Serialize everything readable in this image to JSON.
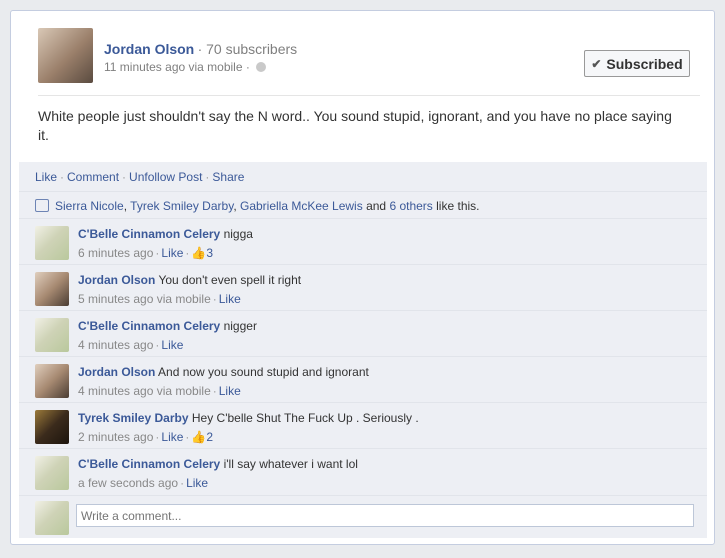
{
  "post": {
    "author": "Jordan Olson",
    "subscribers": "· 70 subscribers",
    "meta": "11 minutes ago via mobile ·",
    "subscribed_label": "Subscribed",
    "text": "White people just shouldn't say the N word.. You sound stupid, ignorant, and you have no place saying it."
  },
  "actions": {
    "like": "Like",
    "comment": "Comment",
    "unfollow": "Unfollow Post",
    "share": "Share",
    "dot": "·"
  },
  "likes": {
    "name1": "Sierra Nicole",
    "name2": "Tyrek Smiley Darby",
    "name3": "Gabriella McKee Lewis",
    "and": "and",
    "others": "6 others",
    "suffix": "like this.",
    "comma": ","
  },
  "comments": [
    {
      "author": "C'Belle Cinnamon Celery",
      "text": "nigga",
      "time": "6 minutes ago",
      "like": "Like",
      "likes_count": "3"
    },
    {
      "author": "Jordan Olson",
      "text": "You don't even spell it right",
      "time": "5 minutes ago via mobile",
      "like": "Like"
    },
    {
      "author": "C'Belle Cinnamon Celery",
      "text": "nigger",
      "time": "4 minutes ago",
      "like": "Like"
    },
    {
      "author": "Jordan Olson",
      "text": "And now you sound stupid and ignorant",
      "time": "4 minutes ago via mobile",
      "like": "Like"
    },
    {
      "author": "Tyrek Smiley Darby",
      "text": "Hey C'belle Shut The Fuck Up . Seriously .",
      "time": "2 minutes ago",
      "like": "Like",
      "likes_count": "2"
    },
    {
      "author": "C'Belle Cinnamon Celery",
      "text": "i'll say whatever i want lol",
      "time": "a few seconds ago",
      "like": "Like"
    }
  ],
  "write": {
    "placeholder": "Write a comment..."
  }
}
